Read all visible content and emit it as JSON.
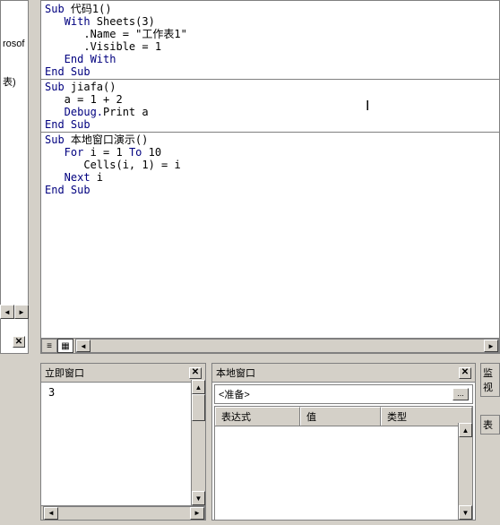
{
  "leftFragment": {
    "line1": "rosof",
    "line2": "表)"
  },
  "code": {
    "sub1_line1_kw": "Sub ",
    "sub1_line1_name": "代码1()",
    "sub1_line2_kw": "   With ",
    "sub1_line2_rest": "Sheets(3)",
    "sub1_line3": "      .Name = \"工作表1\"",
    "sub1_line4": "      .Visible = 1",
    "sub1_line5_kw": "   End With",
    "sub1_line6_kw": "End Sub",
    "sub2_line1_kw": "Sub ",
    "sub2_line1_name": "jiafa()",
    "sub2_line2": "   a = 1 + 2",
    "sub2_line3_kw": "   Debug.",
    "sub2_line3_rest": "Print a",
    "sub2_line4_kw": "End Sub",
    "sub3_line1_kw": "Sub ",
    "sub3_line1_name": "本地窗口演示()",
    "sub3_line2_kw1": "   For ",
    "sub3_line2_mid": "i = 1 ",
    "sub3_line2_kw2": "To ",
    "sub3_line2_end": "10",
    "sub3_line3": "      Cells(i, 1) = i",
    "sub3_line4_kw": "   Next ",
    "sub3_line4_rest": "i",
    "sub3_line5_kw": "End Sub"
  },
  "immediate": {
    "title": "立即窗口",
    "output": " 3 "
  },
  "locals": {
    "title": "本地窗口",
    "ready": "<准备>",
    "col1": "表达式",
    "col2": "值",
    "col3": "类型"
  },
  "watch": {
    "title": "监视",
    "col1": "表"
  },
  "glyphs": {
    "close": "✕",
    "left": "◄",
    "right": "►",
    "up": "▲",
    "down": "▼",
    "dots": "...",
    "cursor": "I"
  }
}
